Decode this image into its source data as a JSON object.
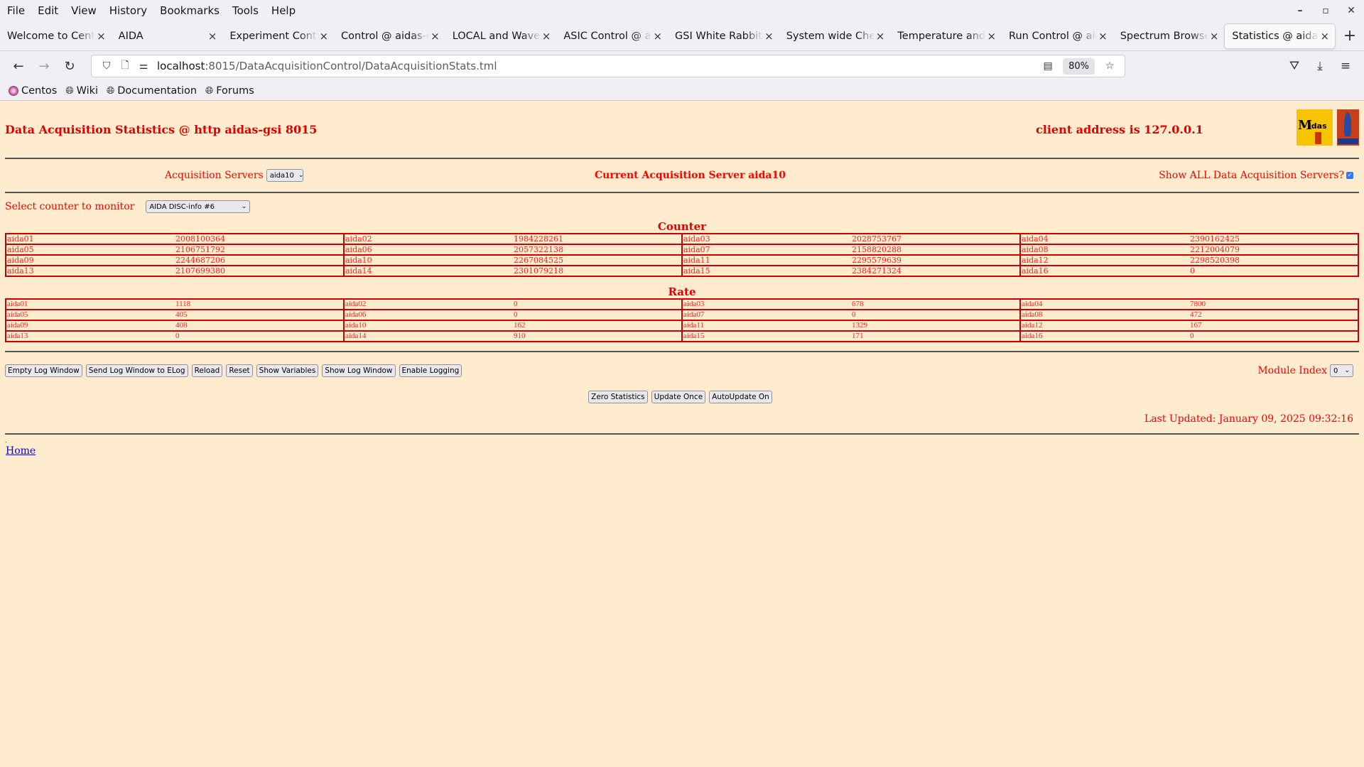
{
  "browser": {
    "menu": [
      "File",
      "Edit",
      "View",
      "History",
      "Bookmarks",
      "Tools",
      "Help"
    ],
    "tabs": [
      {
        "label": "Welcome to CentOS",
        "active": false
      },
      {
        "label": "AIDA",
        "active": false
      },
      {
        "label": "Experiment Control",
        "active": false
      },
      {
        "label": "Control @ aidas-gsi",
        "active": false
      },
      {
        "label": "LOCAL and Waveform",
        "active": false
      },
      {
        "label": "ASIC Control @ aidas",
        "active": false
      },
      {
        "label": "GSI White Rabbit T",
        "active": false
      },
      {
        "label": "System wide Check",
        "active": false
      },
      {
        "label": "Temperature and s",
        "active": false
      },
      {
        "label": "Run Control @ aidas",
        "active": false
      },
      {
        "label": "Spectrum Browser",
        "active": false
      },
      {
        "label": "Statistics @ aidas-gsi",
        "active": true
      }
    ],
    "url_host": "localhost",
    "url_path": ":8015/DataAcquisitionControl/DataAcquisitionStats.tml",
    "zoom": "80%",
    "bookmarks": [
      "Centos",
      "Wiki",
      "Documentation",
      "Forums"
    ]
  },
  "page": {
    "title": "Data Acquisition Statistics @ http aidas-gsi 8015",
    "client_address": "client address is 127.0.0.1",
    "acq_servers_label": "Acquisition Servers",
    "acq_server_selected": "aida10",
    "current_server": "Current Acquisition Server aida10",
    "show_all_label": "Show ALL Data Acquisition Servers?",
    "show_all_checked": true,
    "counter_select_label": "Select counter to monitor",
    "counter_selected": "AIDA DISC-info #6",
    "counter_title": "Counter",
    "rate_title": "Rate",
    "counter_rows": [
      [
        [
          "aida01",
          "2008100364"
        ],
        [
          "aida02",
          "1984228261"
        ],
        [
          "aida03",
          "2028753767"
        ],
        [
          "aida04",
          "2390162425"
        ]
      ],
      [
        [
          "aida05",
          "2106751792"
        ],
        [
          "aida06",
          "2057322138"
        ],
        [
          "aida07",
          "2158820288"
        ],
        [
          "aida08",
          "2212004079"
        ]
      ],
      [
        [
          "aida09",
          "2244687206"
        ],
        [
          "aida10",
          "2267084525"
        ],
        [
          "aida11",
          "2295579639"
        ],
        [
          "aida12",
          "2298520398"
        ]
      ],
      [
        [
          "aida13",
          "2107699380"
        ],
        [
          "aida14",
          "2301079218"
        ],
        [
          "aida15",
          "2384271324"
        ],
        [
          "aida16",
          "0"
        ]
      ]
    ],
    "rate_rows": [
      [
        [
          "aida01",
          "1118"
        ],
        [
          "aida02",
          "0"
        ],
        [
          "aida03",
          "678"
        ],
        [
          "aida04",
          "7800"
        ]
      ],
      [
        [
          "aida05",
          "405"
        ],
        [
          "aida06",
          "0"
        ],
        [
          "aida07",
          "0"
        ],
        [
          "aida08",
          "472"
        ]
      ],
      [
        [
          "aida09",
          "408"
        ],
        [
          "aida10",
          "162"
        ],
        [
          "aida11",
          "1329"
        ],
        [
          "aida12",
          "167"
        ]
      ],
      [
        [
          "aida13",
          "0"
        ],
        [
          "aida14",
          "910"
        ],
        [
          "aida15",
          "171"
        ],
        [
          "aida16",
          "0"
        ]
      ]
    ],
    "buttons_row1": [
      "Empty Log Window",
      "Send Log Window to ELog",
      "Reload",
      "Reset",
      "Show Variables",
      "Show Log Window",
      "Enable Logging"
    ],
    "module_index_label": "Module Index",
    "module_index_selected": "0",
    "buttons_row2": [
      "Zero Statistics",
      "Update Once",
      "AutoUpdate On"
    ],
    "last_updated": "Last Updated: January 09, 2025 09:32:16",
    "home_link": "Home"
  }
}
